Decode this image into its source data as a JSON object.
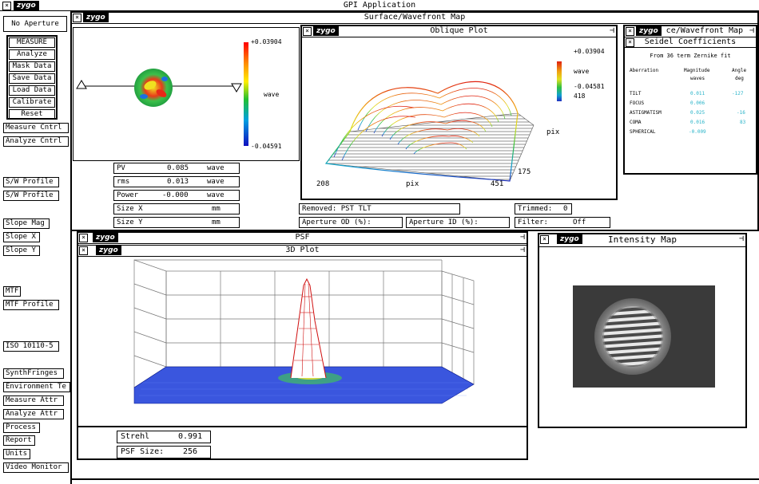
{
  "app_title": "GPI Application",
  "logo_text": "zygo",
  "aperture_button": "No Aperture",
  "measure_group": {
    "title": "MEASURE",
    "buttons": [
      "Analyze",
      "Mask Data",
      "Save Data",
      "Load Data",
      "Calibrate",
      "Reset"
    ]
  },
  "left_buttons": {
    "measure_cntrl": "Measure Cntrl",
    "analyze_cntrl": "Analyze Cntrl",
    "sw_profile_1": "S/W Profile",
    "sw_profile_2": "S/W Profile",
    "slope_mag": "Slope Mag",
    "slope_x": "Slope X",
    "slope_y": "Slope Y",
    "mtf": "MTF",
    "mtf_profile": "MTF Profile",
    "iso": "ISO 10110-5",
    "synth_fringes": "SynthFringes",
    "environment": "Environment Te",
    "measure_attr": "Measure Attr",
    "analyze_attr": "Analyze Attr",
    "process": "Process",
    "report": "Report",
    "units": "Units",
    "video_monitor": "Video Monitor"
  },
  "surface_window": {
    "title": "Surface/Wavefront Map",
    "colorbar_max": "+0.03904",
    "colorbar_min": "-0.04591",
    "colorbar_unit": "wave",
    "stats": {
      "pv": {
        "label": "PV",
        "value": "0.085",
        "unit": "wave"
      },
      "rms": {
        "label": "rms",
        "value": "0.013",
        "unit": "wave"
      },
      "power": {
        "label": "Power",
        "value": "-0.000",
        "unit": "wave"
      },
      "size_x": {
        "label": "Size X",
        "unit": "mm"
      },
      "size_y": {
        "label": "Size Y",
        "unit": "mm"
      }
    },
    "removed": "Removed: PST TLT",
    "trimmed_label": "Trimmed:",
    "trimmed_value": "0",
    "aperture_od": "Aperture OD (%):",
    "aperture_id": "Aperture ID (%):",
    "filter_label": "Filter:",
    "filter_value": "Off"
  },
  "oblique_plot": {
    "title": "Oblique Plot",
    "colorbar_max": "+0.03904",
    "colorbar_unit": "wave",
    "colorbar_min": "-0.04581",
    "side_value": "418",
    "axis_pix_right": "pix",
    "axis_pix_bottom": "pix",
    "tick_175": "175",
    "tick_208": "208",
    "tick_451": "451"
  },
  "seidel_window": {
    "title_partial": "ce/Wavefront Map",
    "inner_title": "Seidel Coefficients",
    "subtitle": "From 36 term Zernike fit",
    "headers": {
      "aberration": "Aberration",
      "magnitude": "Magnitude",
      "magnitude_unit": "waves",
      "angle": "Angle",
      "angle_unit": "deg"
    },
    "rows": [
      {
        "name": "TILT",
        "magnitude": "0.011",
        "angle": "-127"
      },
      {
        "name": "FOCUS",
        "magnitude": "0.006",
        "angle": ""
      },
      {
        "name": "ASTIGMATISM",
        "magnitude": "0.025",
        "angle": "-16"
      },
      {
        "name": "COMA",
        "magnitude": "0.016",
        "angle": "83"
      },
      {
        "name": "SPHERICAL",
        "magnitude": "-0.009",
        "angle": ""
      }
    ]
  },
  "psf_window": {
    "title": "PSF",
    "inner_title": "3D Plot",
    "strehl_label": "Strehl",
    "strehl_value": "0.991",
    "psf_size_label": "PSF Size:",
    "psf_size_value": "256"
  },
  "intensity_window": {
    "title": "Intensity Map"
  },
  "colors": {
    "value_cyan": "#27b3c8",
    "psf_blue": "#1030d8",
    "psf_red": "#d01010"
  }
}
